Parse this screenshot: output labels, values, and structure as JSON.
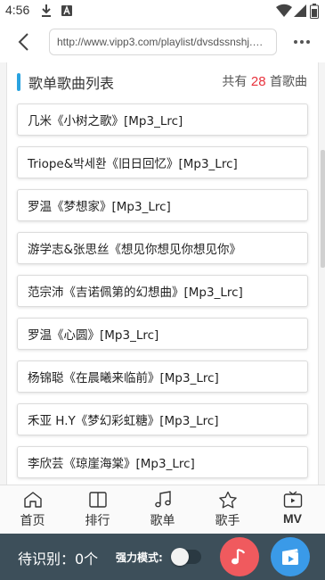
{
  "status_bar": {
    "time": "4:56",
    "icons": [
      "download-icon",
      "font-a-icon",
      "wifi-icon",
      "signal-icon",
      "battery-icon"
    ]
  },
  "browser": {
    "url": "http://www.vipp3.com/playlist/dvsdssnshj.html",
    "back_icon": "chevron-left-icon",
    "more_icon": "more-dots-icon"
  },
  "list": {
    "title": "歌单歌曲列表",
    "count_prefix": "共有",
    "count": "28",
    "count_suffix": "首歌曲",
    "accent_color": "#2aa3e0",
    "count_color": "#e8323c",
    "songs": [
      "几米《小树之歌》[Mp3_Lrc]",
      "Triope&박세환《旧日回忆》[Mp3_Lrc]",
      "罗温《梦想家》[Mp3_Lrc]",
      "游学志&张思丝《想见你想见你想见你》",
      "范宗沛《吉诺佩第的幻想曲》[Mp3_Lrc]",
      "罗温《心圆》[Mp3_Lrc]",
      "杨锦聪《在晨曦来临前》[Mp3_Lrc]",
      "禾亚 H.Y《梦幻彩虹糖》[Mp3_Lrc]",
      "李欣芸《琼崖海棠》[Mp3_Lrc]"
    ]
  },
  "tabs": [
    {
      "label": "首页",
      "icon": "home-icon"
    },
    {
      "label": "排行",
      "icon": "book-icon"
    },
    {
      "label": "歌单",
      "icon": "music-note-icon"
    },
    {
      "label": "歌手",
      "icon": "star-icon"
    },
    {
      "label": "MV",
      "icon": "tv-icon"
    }
  ],
  "bottom_bar": {
    "pending_text": "待识别：0个",
    "strong_mode_label": "强力模式:",
    "strong_mode_on": false,
    "music_button_icon": "music-note-icon",
    "video_button_icon": "video-clapper-icon",
    "bar_color": "#3d4f5a",
    "music_button_color": "#f05a5e",
    "video_button_color": "#3a9ae8"
  }
}
